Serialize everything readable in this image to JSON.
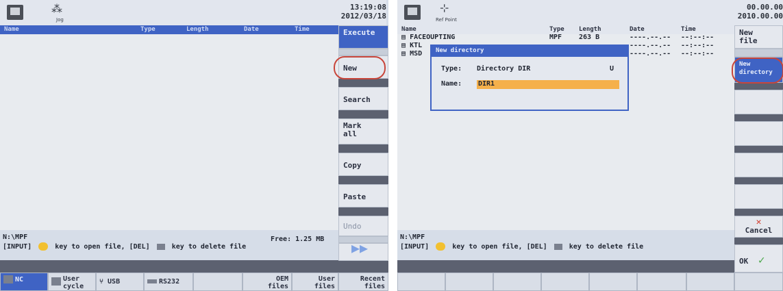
{
  "left": {
    "mode_icon": "machine-mode-icon",
    "status_icon": "jog-icon",
    "status_label": "Jog",
    "clock": {
      "time": "13:19:08",
      "date": "2012/03/18"
    },
    "columns": {
      "name": "Name",
      "type": "Type",
      "length": "Length",
      "date": "Date",
      "time": "Time"
    },
    "softkeys": {
      "execute": "Execute",
      "new": "New",
      "search": "Search",
      "mark_all_1": "Mark",
      "mark_all_2": "all",
      "copy": "Copy",
      "paste": "Paste",
      "undo": "Undo"
    },
    "path": "N:\\MPF",
    "free": "Free: 1.25 MB",
    "hint_a": "[INPUT]",
    "hint_b": "key to open file, [DEL]",
    "hint_c": "key to delete file",
    "hbar": [
      {
        "l1": "NC",
        "l2": ""
      },
      {
        "l1": "User",
        "l2": "cycle"
      },
      {
        "l1": "USB",
        "l2": ""
      },
      {
        "l1": "RS232",
        "l2": ""
      },
      {
        "l1": "",
        "l2": ""
      },
      {
        "l1": "OEM",
        "l2": "files"
      },
      {
        "l1": "User",
        "l2": "files"
      },
      {
        "l1": "Recent",
        "l2": "files"
      }
    ]
  },
  "right": {
    "status_label": "Ref Point",
    "clock": {
      "time": "00.00.00",
      "date": "2010.00.00"
    },
    "columns": {
      "name": "Name",
      "type": "Type",
      "length": "Length",
      "date": "Date",
      "time": "Time"
    },
    "rows": [
      {
        "name": "FACEOUPTING",
        "type": "MPF",
        "length": "263 B",
        "date": "----.--.--",
        "time": "--:--:--"
      },
      {
        "name": "KTL",
        "type": "",
        "length": "",
        "date": "----.--.--",
        "time": "--:--:--"
      },
      {
        "name": "MSD",
        "type": "",
        "length": "",
        "date": "----.--.--",
        "time": "--:--:--"
      }
    ],
    "dialog": {
      "title": "New directory",
      "type_label": "Type:",
      "type_value": "Directory DIR",
      "type_key": "U",
      "name_label": "Name:",
      "name_value": "DIR1"
    },
    "softkeys": {
      "new_file_1": "New",
      "new_file_2": "file",
      "new_dir_1": "New",
      "new_dir_2": "directory",
      "cancel": "Cancel",
      "ok": "OK"
    },
    "path": "N:\\MPF",
    "hint_a": "[INPUT]",
    "hint_b": "key to open file, [DEL]",
    "hint_c": "key to delete file"
  },
  "colors": {
    "accent": "#3f63c4",
    "highlight": "#c8453a",
    "field": "#f5b04b",
    "ok": "#4aa84a",
    "cancel": "#d23a2a"
  }
}
